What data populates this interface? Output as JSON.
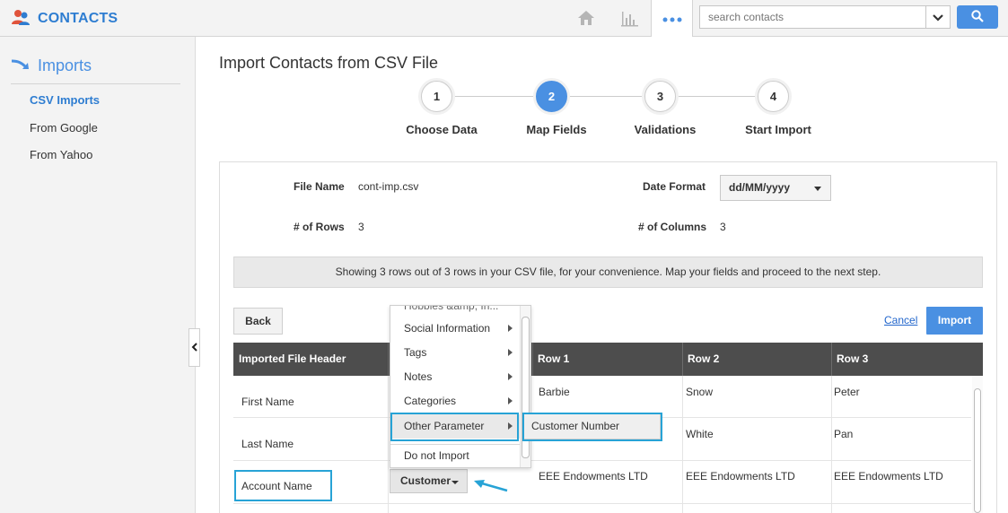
{
  "app": {
    "title": "CONTACTS"
  },
  "search": {
    "placeholder": "search contacts"
  },
  "sidebar": {
    "heading": "Imports",
    "items": [
      {
        "label": "CSV Imports",
        "active": true
      },
      {
        "label": "From Google",
        "active": false
      },
      {
        "label": "From Yahoo",
        "active": false
      }
    ]
  },
  "page": {
    "title": "Import Contacts from CSV File"
  },
  "steps": [
    {
      "number": "1",
      "label": "Choose Data",
      "active": false
    },
    {
      "number": "2",
      "label": "Map Fields",
      "active": true
    },
    {
      "number": "3",
      "label": "Validations",
      "active": false
    },
    {
      "number": "4",
      "label": "Start Import",
      "active": false
    }
  ],
  "file_info": {
    "file_name_label": "File Name",
    "file_name": "cont-imp.csv",
    "rows_label": "# of Rows",
    "rows": "3",
    "date_format_label": "Date Format",
    "date_format": "dd/MM/yyyy",
    "columns_label": "# of Columns",
    "columns": "3"
  },
  "info_message": "Showing 3 rows out of 3 rows in your CSV file, for your convenience. Map your fields and proceed to the next step.",
  "actions": {
    "back": "Back",
    "cancel": "Cancel",
    "import": "Import"
  },
  "table": {
    "headers": [
      "Imported File Header",
      "Row 1",
      "Row 2",
      "Row 3"
    ],
    "rows": [
      {
        "header": "First Name",
        "values": [
          "Barbie",
          "Snow",
          "Peter"
        ]
      },
      {
        "header": "Last Name",
        "values": [
          "",
          "White",
          "Pan"
        ]
      },
      {
        "header": "Account Name",
        "mapping": "Customer",
        "values": [
          "EEE Endowments LTD",
          "EEE Endowments LTD",
          "EEE Endowments LTD"
        ]
      }
    ]
  },
  "dropdown_menu": {
    "partial_item": "Hobbies &amp; In...",
    "items": [
      {
        "label": "Social Information",
        "submenu": true
      },
      {
        "label": "Tags",
        "submenu": true
      },
      {
        "label": "Notes",
        "submenu": true
      },
      {
        "label": "Categories",
        "submenu": true
      },
      {
        "label": "Other Parameter",
        "submenu": true
      },
      {
        "label": "Do not Import",
        "submenu": false
      }
    ],
    "submenu_item": "Customer Number"
  },
  "colors": {
    "accent": "#4a90e2",
    "highlight": "#27a3d6",
    "header_bg": "#4d4d4d"
  }
}
